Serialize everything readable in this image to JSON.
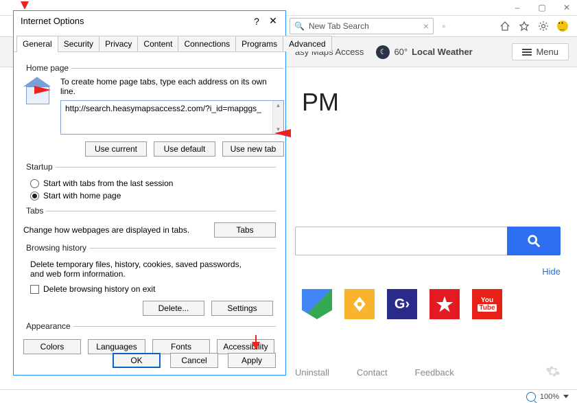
{
  "window": {
    "controls": {
      "min": "–",
      "max": "▢",
      "close": "✕"
    }
  },
  "chrome": {
    "tab_label": "New Tab Search",
    "icons": {
      "home": "home",
      "fav": "star",
      "gear": "gear",
      "smiley": "smiley"
    }
  },
  "toolbar": {
    "maps_link": "asy Maps Access",
    "weather_temp": "60°",
    "weather_label": "Local Weather",
    "menu_label": "Menu"
  },
  "page": {
    "pm_text": "PM",
    "hide": "Hide",
    "tiles": {
      "gmaps": "",
      "ymaps": "",
      "gas": "G›",
      "macys": "★",
      "yt_top": "You",
      "yt_bot": "Tube"
    },
    "footer": {
      "uninstall": "Uninstall",
      "contact": "Contact",
      "feedback": "Feedback"
    }
  },
  "statusbar": {
    "zoom": "100%"
  },
  "dialog": {
    "title": "Internet Options",
    "help": "?",
    "close": "✕",
    "tabs": [
      "General",
      "Security",
      "Privacy",
      "Content",
      "Connections",
      "Programs",
      "Advanced"
    ],
    "homepage": {
      "legend": "Home page",
      "desc": "To create home page tabs, type each address on its own line.",
      "value": "http://search.heasymapsaccess2.com/?i_id=mapggs_",
      "use_current": "Use current",
      "use_default": "Use default",
      "use_new_tab": "Use new tab"
    },
    "startup": {
      "legend": "Startup",
      "opt_last": "Start with tabs from the last session",
      "opt_home": "Start with home page"
    },
    "tabs_section": {
      "legend": "Tabs",
      "desc": "Change how webpages are displayed in tabs.",
      "button": "Tabs"
    },
    "browsing_history": {
      "legend": "Browsing history",
      "desc": "Delete temporary files, history, cookies, saved passwords, and web form information.",
      "chk": "Delete browsing history on exit",
      "delete": "Delete...",
      "settings": "Settings"
    },
    "appearance": {
      "legend": "Appearance",
      "colors": "Colors",
      "languages": "Languages",
      "fonts": "Fonts",
      "accessibility": "Accessibility"
    },
    "footer": {
      "ok": "OK",
      "cancel": "Cancel",
      "apply": "Apply"
    }
  }
}
